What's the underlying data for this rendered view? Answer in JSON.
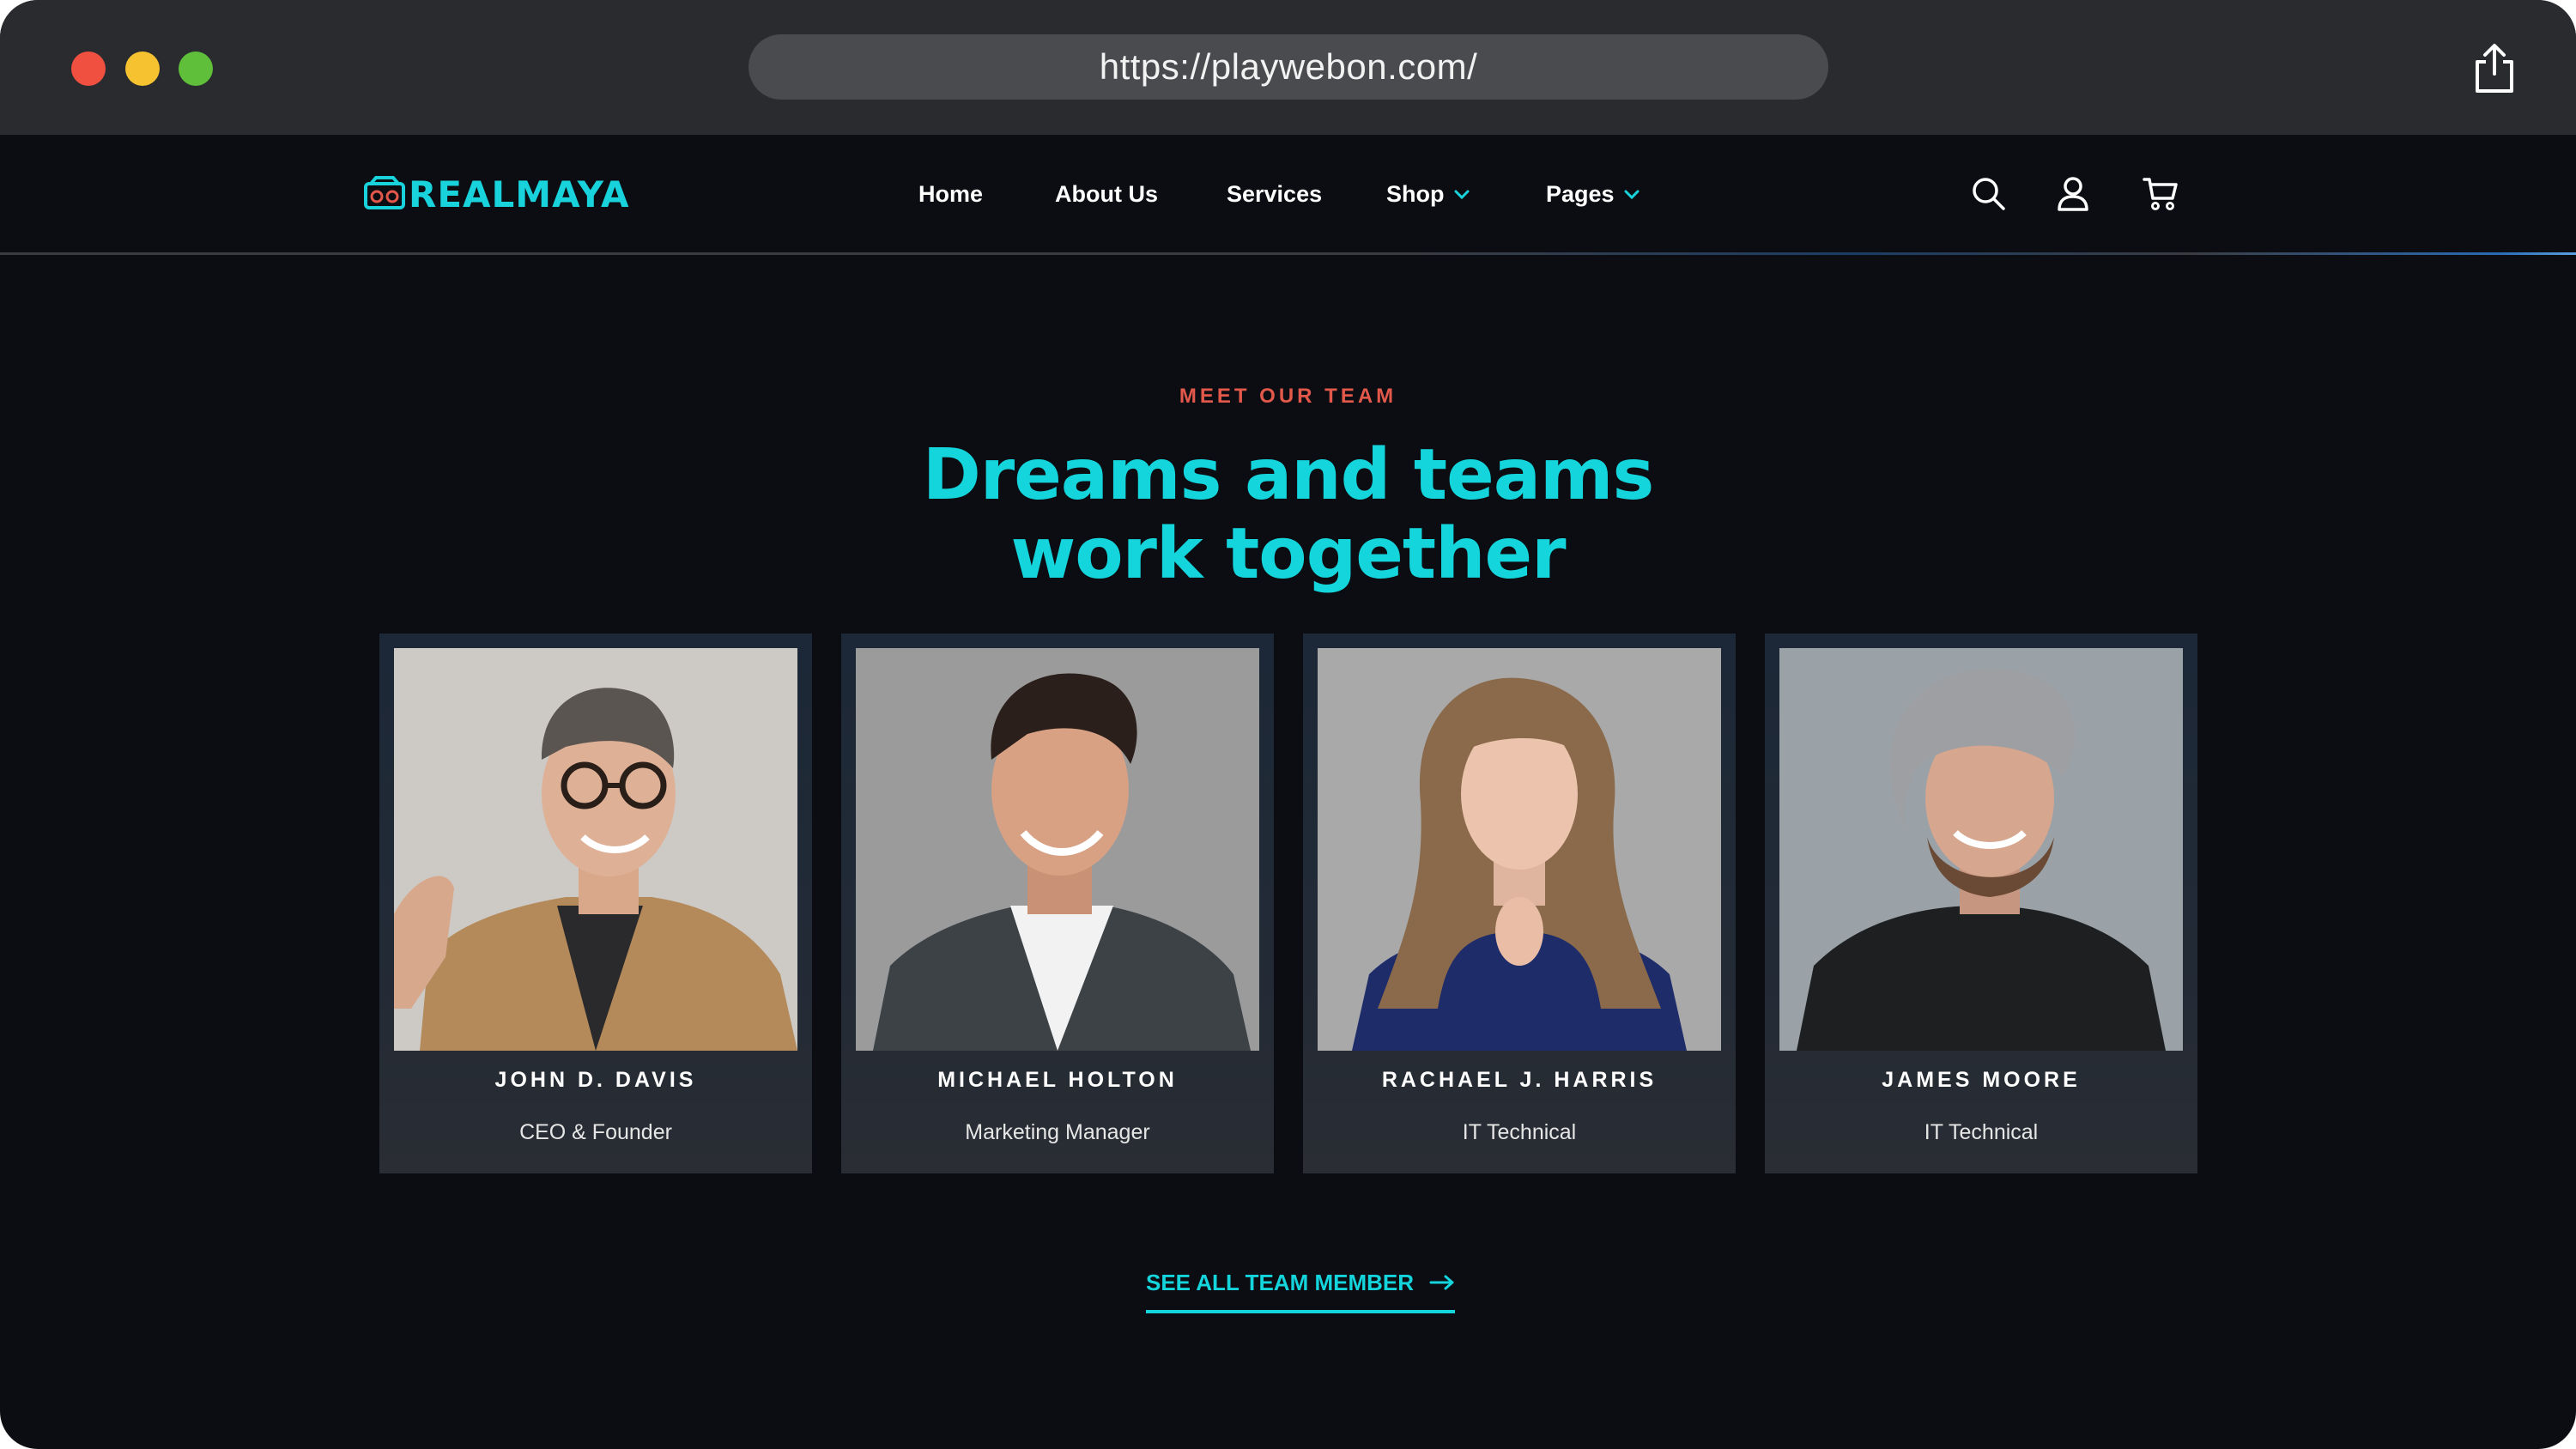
{
  "browser": {
    "url": "https://playwebon.com/"
  },
  "header": {
    "logo_text": "REALMAYA",
    "nav": [
      {
        "label": "Home",
        "has_dropdown": false
      },
      {
        "label": "About Us",
        "has_dropdown": false
      },
      {
        "label": "Services",
        "has_dropdown": false
      },
      {
        "label": "Shop",
        "has_dropdown": true
      },
      {
        "label": "Pages",
        "has_dropdown": true
      }
    ],
    "icons": [
      "search-icon",
      "user-icon",
      "cart-icon"
    ]
  },
  "team": {
    "eyebrow": "MEET OUR TEAM",
    "headline_line1": "Dreams and teams",
    "headline_line2": "work together",
    "members": [
      {
        "name": "JOHN D. DAVIS",
        "role": "CEO & Founder"
      },
      {
        "name": "MICHAEL HOLTON",
        "role": "Marketing Manager"
      },
      {
        "name": "RACHAEL J. HARRIS",
        "role": "IT Technical"
      },
      {
        "name": "JAMES MOORE",
        "role": "IT Technical"
      }
    ],
    "cta_label": "SEE ALL TEAM MEMBER"
  },
  "colors": {
    "accent": "#14d4dc",
    "eyebrow": "#e2584a",
    "background": "#0b0d12",
    "card": "#1e2835"
  }
}
